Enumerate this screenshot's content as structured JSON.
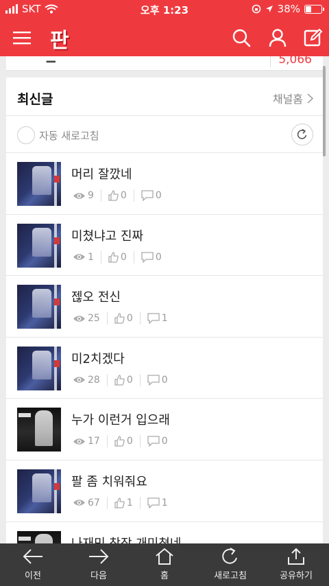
{
  "status_bar": {
    "carrier": "SKT",
    "time": "오후 1:23",
    "battery": "38%",
    "battery_level": 0.38
  },
  "header": {
    "logo": "판",
    "icons": [
      "hamburger-menu-icon",
      "search-icon",
      "user-icon",
      "compose-icon"
    ]
  },
  "peek_card": {
    "count": "5,066"
  },
  "latest": {
    "title": "최신글",
    "channel_home": "채널홈",
    "auto_refresh": "자동 새로고침"
  },
  "posts": [
    {
      "title": "머리 잘깠네",
      "views": "9",
      "likes": "0",
      "comments": "0",
      "thumb": "concert"
    },
    {
      "title": "미쳤냐고 진짜",
      "views": "1",
      "likes": "0",
      "comments": "0",
      "thumb": "concert"
    },
    {
      "title": "젢오 전신",
      "views": "25",
      "likes": "0",
      "comments": "1",
      "thumb": "concert"
    },
    {
      "title": "미2치겠다",
      "views": "28",
      "likes": "0",
      "comments": "0",
      "thumb": "concert"
    },
    {
      "title": "누가 이런거 입으래",
      "views": "17",
      "likes": "0",
      "comments": "0",
      "thumb": "dark"
    },
    {
      "title": "팔 좀 치워줘요",
      "views": "67",
      "likes": "1",
      "comments": "1",
      "thumb": "concert"
    },
    {
      "title": "나재민 착장 개미쳤네",
      "views": "",
      "likes": "",
      "comments": "",
      "thumb": "dark"
    }
  ],
  "bottom_nav": {
    "back": "이전",
    "forward": "다음",
    "home": "홈",
    "refresh": "새로고침",
    "share": "공유하기"
  },
  "colors": {
    "brand_red": "#ee3a3f",
    "bottom_bar": "#3a3a3a"
  }
}
